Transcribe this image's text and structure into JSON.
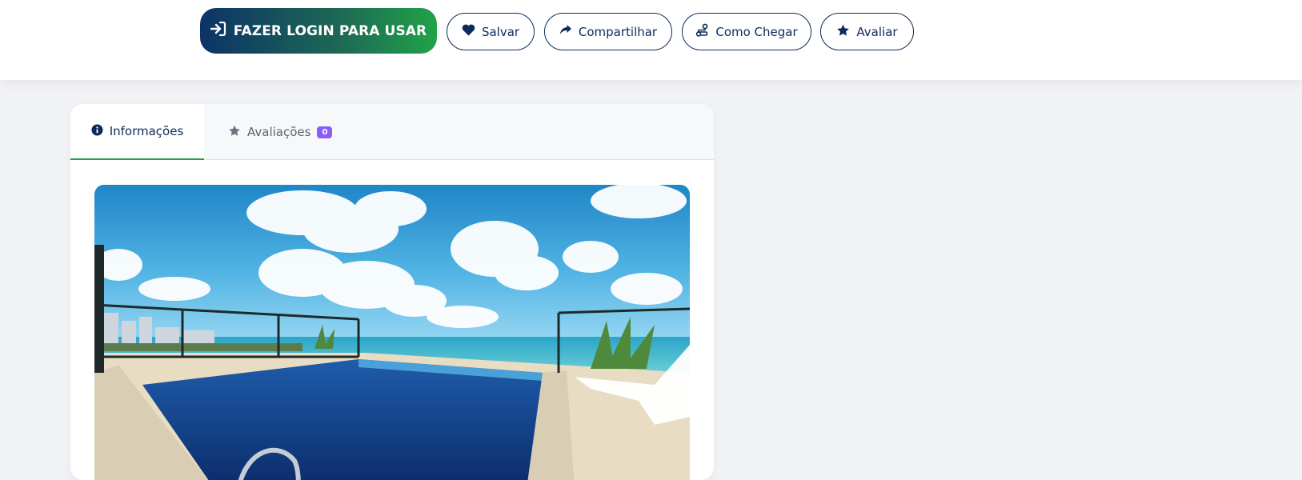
{
  "actions": {
    "login_label": "FAZER LOGIN PARA USAR",
    "save_label": "Salvar",
    "share_label": "Compartilhar",
    "directions_label": "Como Chegar",
    "rate_label": "Avaliar"
  },
  "tabs": [
    {
      "label": "Informações",
      "active": true
    },
    {
      "label": "Avaliações",
      "badge": "0"
    }
  ],
  "colors": {
    "navy": "#0d2a5a",
    "green": "#21a348",
    "badge": "#8b5cf6"
  },
  "icons": [
    "sign-in-icon",
    "heart-icon",
    "share-icon",
    "route-icon",
    "star-icon",
    "info-icon"
  ]
}
